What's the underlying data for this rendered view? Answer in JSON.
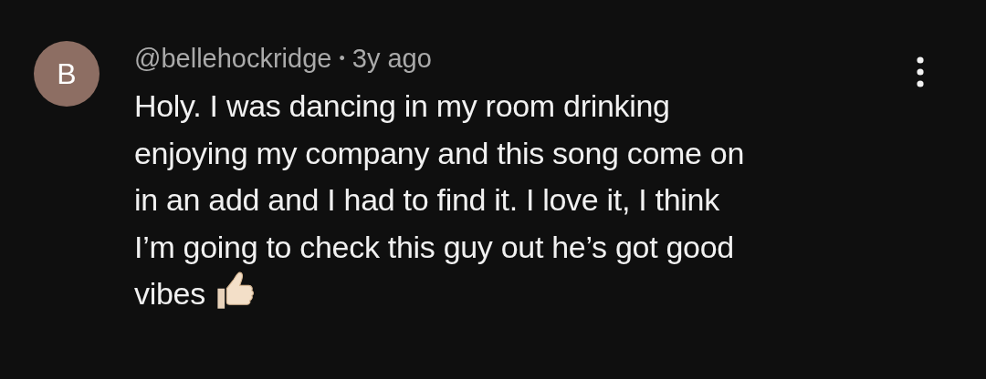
{
  "comment": {
    "avatar_letter": "B",
    "author": "@bellehockridge",
    "separator": "•",
    "time": "3y ago",
    "text_lines": [
      "Holy. I was dancing in my room drinking",
      "enjoying my company and this song come on",
      "in an add and I had to find it. I love it, I think",
      "I’m going to check this guy out he’s got good",
      "vibes"
    ]
  }
}
